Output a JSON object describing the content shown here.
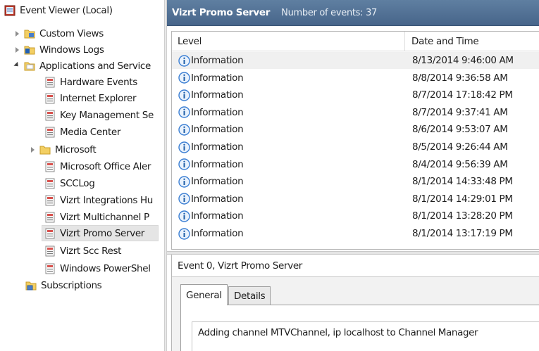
{
  "tree": {
    "root": "Event Viewer (Local)",
    "items": [
      {
        "label": "Custom Views",
        "expander": "right"
      },
      {
        "label": "Windows Logs",
        "expander": "right"
      },
      {
        "label": "Applications and Service",
        "expander": "down"
      },
      {
        "label": "Hardware Events"
      },
      {
        "label": "Internet Explorer"
      },
      {
        "label": "Key Management Se"
      },
      {
        "label": "Media Center"
      },
      {
        "label": "Microsoft",
        "expander": "right"
      },
      {
        "label": "Microsoft Office Aler"
      },
      {
        "label": "SCCLog"
      },
      {
        "label": "Vizrt Integrations Hu"
      },
      {
        "label": "Vizrt Multichannel P"
      },
      {
        "label": "Vizrt Promo Server",
        "selected": true
      },
      {
        "label": "Vizrt Scc Rest"
      },
      {
        "label": "Windows PowerShel"
      },
      {
        "label": "Subscriptions"
      }
    ]
  },
  "log": {
    "title": "Vizrt Promo Server",
    "count_label": "Number of events: 37",
    "columns": {
      "level": "Level",
      "date": "Date and Time"
    },
    "rows": [
      {
        "level": "Information",
        "date": "8/13/2014 9:46:00 AM"
      },
      {
        "level": "Information",
        "date": "8/8/2014 9:36:58 AM"
      },
      {
        "level": "Information",
        "date": "8/7/2014 17:18:42 PM"
      },
      {
        "level": "Information",
        "date": "8/7/2014 9:37:41 AM"
      },
      {
        "level": "Information",
        "date": "8/6/2014 9:53:07 AM"
      },
      {
        "level": "Information",
        "date": "8/5/2014 9:26:44 AM"
      },
      {
        "level": "Information",
        "date": "8/4/2014 9:56:39 AM"
      },
      {
        "level": "Information",
        "date": "8/1/2014 14:33:48 PM"
      },
      {
        "level": "Information",
        "date": "8/1/2014 14:29:01 PM"
      },
      {
        "level": "Information",
        "date": "8/1/2014 13:28:20 PM"
      },
      {
        "level": "Information",
        "date": "8/1/2014 13:17:19 PM"
      }
    ]
  },
  "detail": {
    "header": "Event 0, Vizrt Promo Server",
    "tabs": {
      "general": "General",
      "details": "Details"
    },
    "message": "Adding channel MTVChannel, ip localhost to Channel Manager"
  },
  "colors": {
    "titlebar": "#4f6e8f",
    "info_icon": "#3b7fd4",
    "folder": "#f3cf63"
  }
}
